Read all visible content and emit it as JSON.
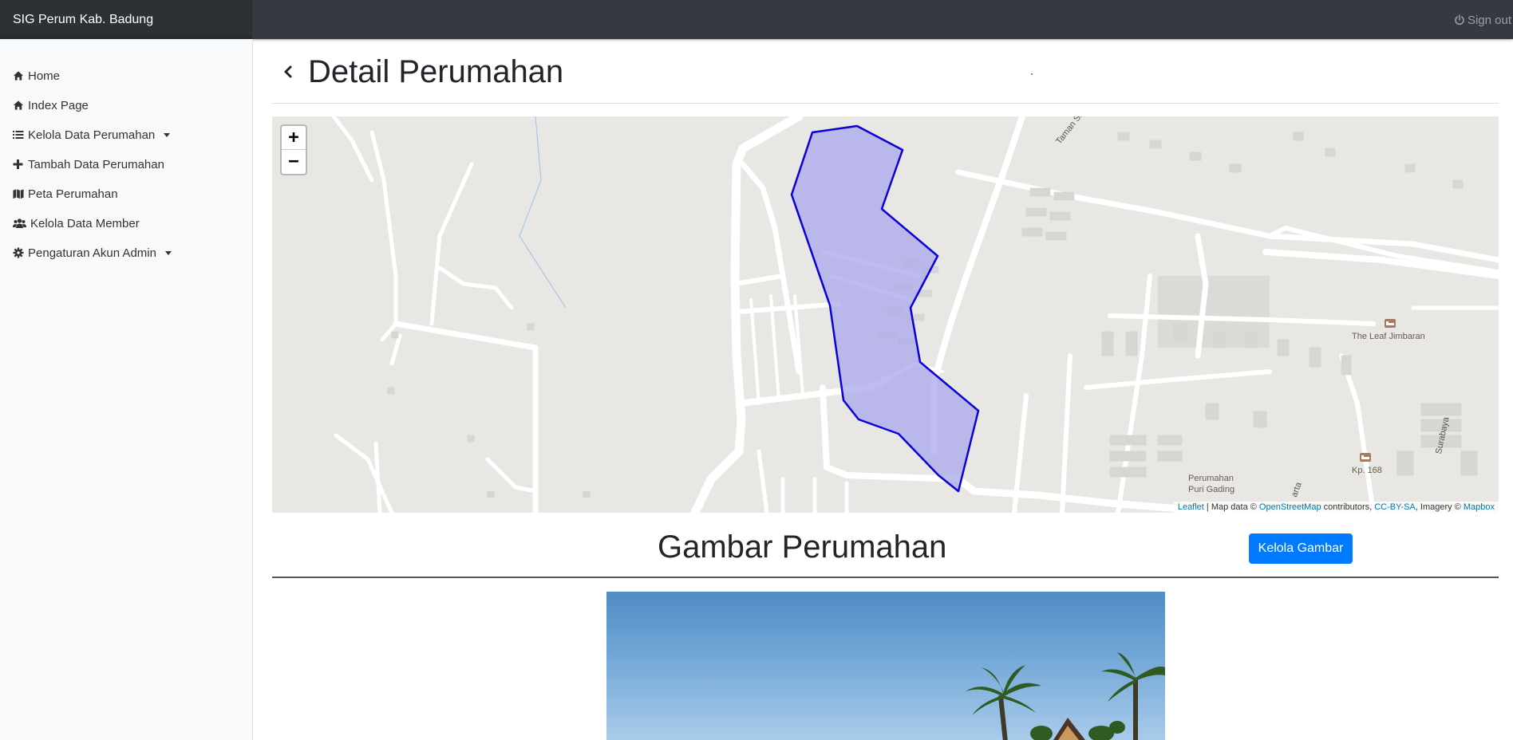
{
  "app": {
    "title": "SIG Perum Kab. Badung",
    "signout_label": "Sign out"
  },
  "sidebar": {
    "items": [
      {
        "label": "Home",
        "icon": "home-icon"
      },
      {
        "label": "Index Page",
        "icon": "home-icon"
      },
      {
        "label": "Kelola Data Perumahan",
        "icon": "list-icon",
        "dropdown": true
      },
      {
        "label": "Tambah Data Perumahan",
        "icon": "plus-icon"
      },
      {
        "label": "Peta Perumahan",
        "icon": "map-icon"
      },
      {
        "label": "Kelola Data Member",
        "icon": "users-icon"
      },
      {
        "label": "Pengaturan Akun Admin",
        "icon": "gear-icon",
        "dropdown": true
      }
    ]
  },
  "page": {
    "title": "Detail Perumahan"
  },
  "map": {
    "zoom_in": "+",
    "zoom_out": "−",
    "labels": {
      "street_1": "Taman Sakura",
      "poi_1": "The Leaf Jimbaran",
      "street_2": "Surabaya",
      "poi_2": "Kp. 168",
      "poi_3_line1": "Perumahan",
      "poi_3_line2": "Puri Gading",
      "street_3": "arta"
    },
    "attribution": {
      "leaflet": "Leaflet",
      "map_data": " | Map data © ",
      "osm": "OpenStreetMap",
      "contributors": " contributors, ",
      "license": "CC-BY-SA",
      "imagery": ", Imagery © ",
      "mapbox": "Mapbox"
    },
    "polygon_fill": "#aeaceb",
    "polygon_stroke": "#0a00d8"
  },
  "gallery": {
    "title": "Gambar Perumahan",
    "manage_button": "Kelola Gambar"
  },
  "colors": {
    "navbar": "#343a40",
    "sidebar": "#f8f9fa",
    "primary": "#007bff"
  }
}
